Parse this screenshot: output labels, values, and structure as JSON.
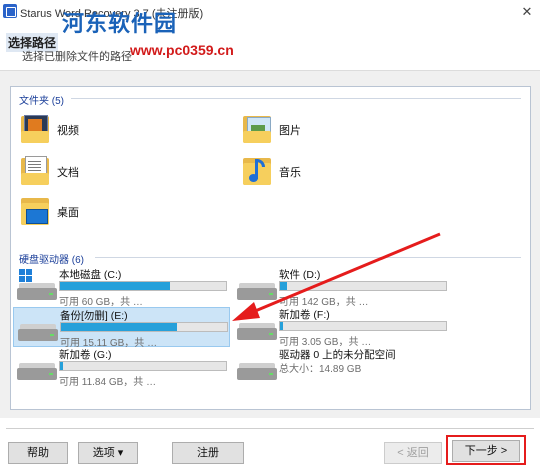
{
  "window": {
    "title": "Starus Word Recovery 3.7 (未注册版)",
    "close_glyph": "✕"
  },
  "watermark": {
    "logo_text": "河东软件园",
    "url": "www.pc0359.cn"
  },
  "header": {
    "title": "选择路径",
    "subtitle": "选择已删除文件的路径"
  },
  "folders_group": {
    "label": "文件夹 (5)"
  },
  "folders": [
    {
      "label": "视频",
      "icon": "videos-folder-icon"
    },
    {
      "label": "图片",
      "icon": "pictures-folder-icon"
    },
    {
      "label": "文档",
      "icon": "documents-folder-icon"
    },
    {
      "label": "音乐",
      "icon": "music-folder-icon"
    },
    {
      "label": "桌面",
      "icon": "desktop-folder-icon"
    }
  ],
  "drives_group": {
    "label": "硬盘驱动器 (6)"
  },
  "drives": [
    {
      "name": "本地磁盘 (C:)",
      "free": "可用 60 GB，共 …",
      "used_fraction": 0.66,
      "selected": false,
      "system": true
    },
    {
      "name": "软件 (D:)",
      "free": "可用 142 GB，共 …",
      "used_fraction": 0.04,
      "selected": false,
      "system": false
    },
    {
      "name": "备份[勿删] (E:)",
      "free": "可用 15.11 GB，共 …",
      "used_fraction": 0.7,
      "selected": true,
      "system": false
    },
    {
      "name": "新加卷 (F:)",
      "free": "可用 3.05 GB，共 …",
      "used_fraction": 0.02,
      "selected": false,
      "system": false
    },
    {
      "name": "新加卷 (G:)",
      "free": "可用 11.84 GB，共 …",
      "used_fraction": 0.02,
      "selected": false,
      "system": false
    },
    {
      "name": "驱动器 0 上的未分配空间",
      "free": "总大小：14.89 GB",
      "used_fraction": 0,
      "selected": false,
      "system": false,
      "no_bar": true
    }
  ],
  "footer": {
    "help_label": "帮助",
    "options_label": "选项 ▾",
    "register_label": "注册",
    "back_label": "< 返回",
    "next_label": "下一步 >"
  },
  "colors": {
    "accent": "#26a0da",
    "annotation": "#e51c1c",
    "selection": "#cce4f7"
  }
}
